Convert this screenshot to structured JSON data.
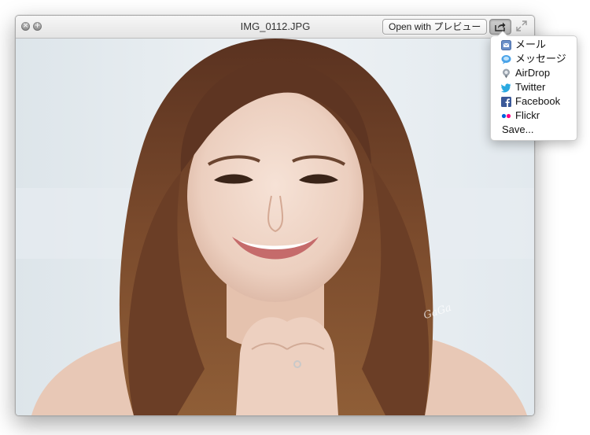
{
  "window": {
    "title": "IMG_0112.JPG",
    "open_with_label": "Open with プレビュー",
    "close_symbol": "×",
    "fullscreen_symbol": "+"
  },
  "photo": {
    "watermark": "GaGa"
  },
  "share_menu": {
    "items": [
      {
        "label": "メール",
        "icon": "mail-icon"
      },
      {
        "label": "メッセージ",
        "icon": "messages-icon"
      },
      {
        "label": "AirDrop",
        "icon": "airdrop-icon"
      },
      {
        "label": "Twitter",
        "icon": "twitter-icon"
      },
      {
        "label": "Facebook",
        "icon": "facebook-icon"
      },
      {
        "label": "Flickr",
        "icon": "flickr-icon"
      },
      {
        "label": "Save..."
      }
    ]
  },
  "colors": {
    "twitter": "#2aa9e0",
    "facebook": "#3b5998",
    "flickr_blue": "#0063dc",
    "flickr_pink": "#ff0084"
  }
}
